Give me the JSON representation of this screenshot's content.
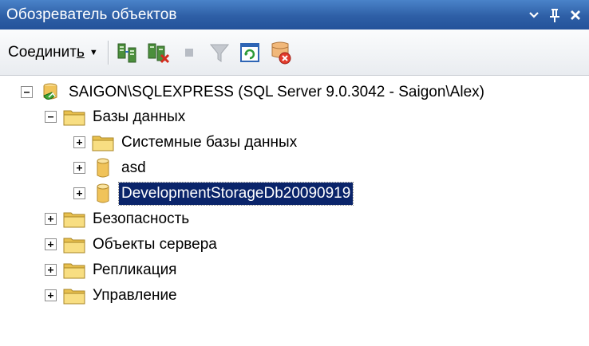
{
  "window": {
    "title": "Обозреватель объектов"
  },
  "toolbar": {
    "connect_label": "Соединить",
    "connect_shortcut": "ь",
    "buttons": [
      {
        "icon": "connect-explorer-icon"
      },
      {
        "icon": "disconnect-icon"
      },
      {
        "icon": "stop-icon"
      },
      {
        "icon": "filter-icon"
      },
      {
        "icon": "refresh-icon"
      },
      {
        "icon": "summary-icon"
      }
    ]
  },
  "tree": {
    "server": "SAIGON\\SQLEXPRESS (SQL Server 9.0.3042 - Saigon\\Alex)",
    "databases": "Базы данных",
    "system_databases": "Системные базы данных",
    "db_asd": "asd",
    "db_dev": "DevelopmentStorageDb20090919",
    "security": "Безопасность",
    "server_objects": "Объекты сервера",
    "replication": "Репликация",
    "management": "Управление"
  },
  "colors": {
    "titlebar": "#2e5fa6",
    "selection": "#0a246a",
    "folder": "#f3d56a"
  }
}
